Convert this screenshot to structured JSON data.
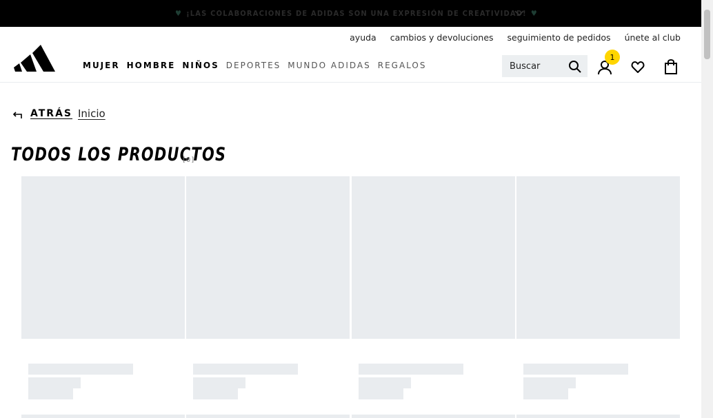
{
  "promo": {
    "text": "¡LAS COLABORACIONES DE ADIDAS SON UNA EXPRESIÓN DE CREATIVIDAD!",
    "heart_glyph": "♥"
  },
  "utility_nav": [
    "ayuda",
    "cambios y devoluciones",
    "seguimiento de pedidos",
    "únete al club"
  ],
  "main_nav": {
    "bold": [
      "MUJER",
      "HOMBRE",
      "NIÑOS"
    ],
    "light": [
      "DEPORTES",
      "MUNDO ADIDAS",
      "REGALOS"
    ]
  },
  "search": {
    "placeholder": "Buscar"
  },
  "account": {
    "badge_count": "1"
  },
  "breadcrumb": {
    "back": "ATRÁS",
    "home": "Inicio"
  },
  "page": {
    "title": "TODOS LOS PRODUCTOS",
    "count": "[0]"
  },
  "icons": [
    "chevron-down-icon",
    "search-icon",
    "account-icon",
    "heart-icon",
    "bag-icon",
    "back-arrow-icon"
  ],
  "colors": {
    "placeholder": "#e9ecef",
    "badge": "#ffd500",
    "promo_bg": "#000000"
  },
  "grid": {
    "loading_cards": 4
  }
}
